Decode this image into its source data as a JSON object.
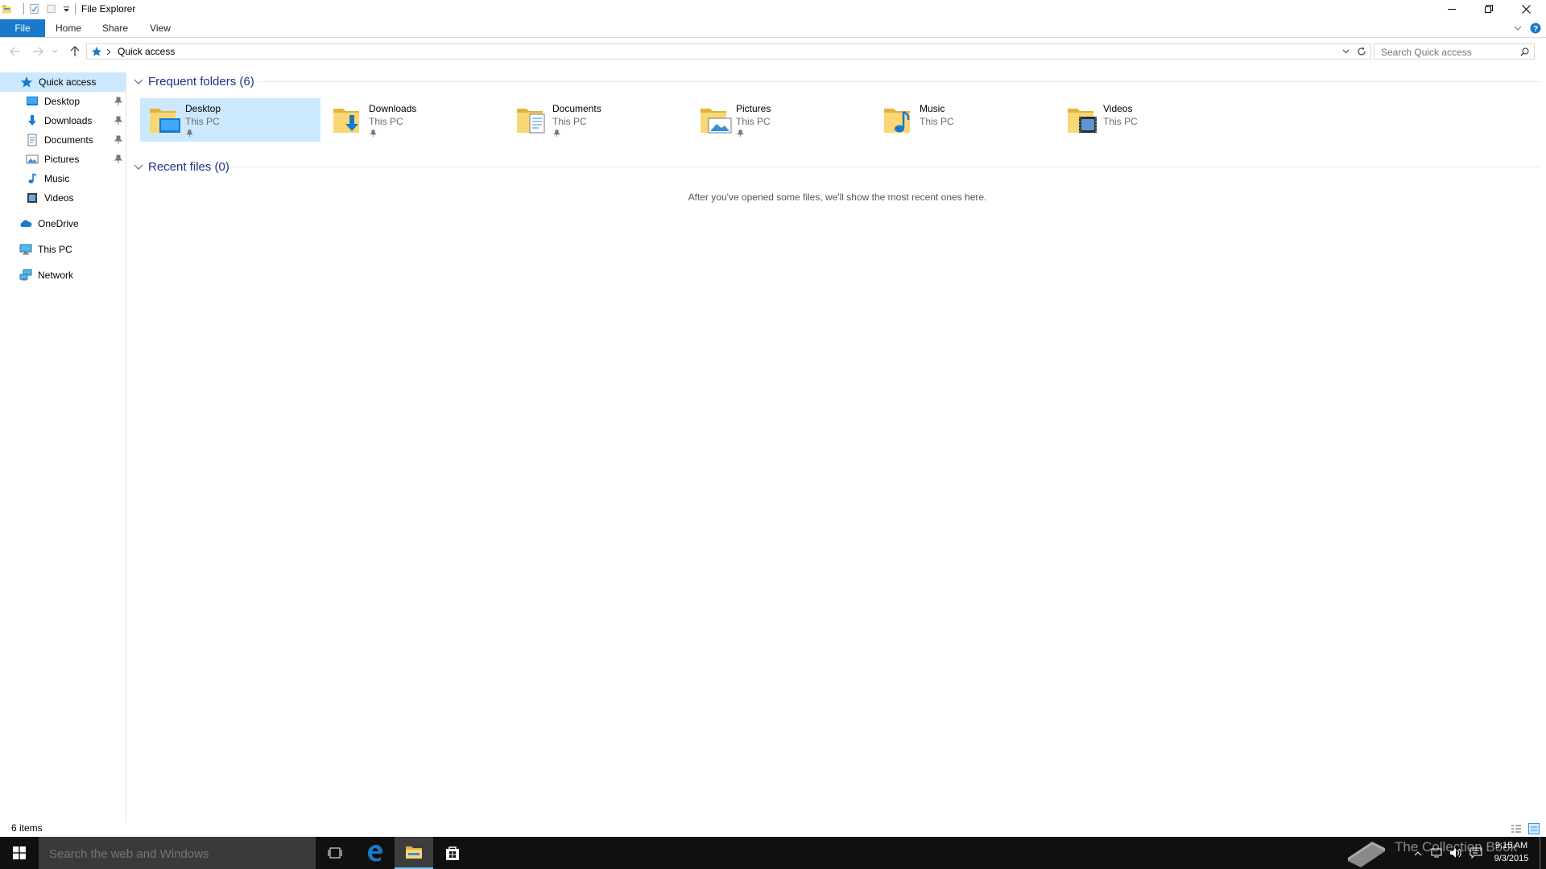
{
  "window": {
    "title": "File Explorer"
  },
  "ribbon": {
    "tabs": [
      {
        "label": "File"
      },
      {
        "label": "Home"
      },
      {
        "label": "Share"
      },
      {
        "label": "View"
      }
    ]
  },
  "address": {
    "location": "Quick access",
    "search_placeholder": "Search Quick access"
  },
  "nav_pane": {
    "items": [
      {
        "label": "Quick access",
        "icon": "star-icon",
        "selected": true
      },
      {
        "label": "Desktop",
        "icon": "desktop-icon",
        "pinned": true
      },
      {
        "label": "Downloads",
        "icon": "downloads-icon",
        "pinned": true
      },
      {
        "label": "Documents",
        "icon": "documents-icon",
        "pinned": true
      },
      {
        "label": "Pictures",
        "icon": "pictures-icon",
        "pinned": true
      },
      {
        "label": "Music",
        "icon": "music-icon"
      },
      {
        "label": "Videos",
        "icon": "videos-icon"
      },
      {
        "label": "OneDrive",
        "icon": "onedrive-icon"
      },
      {
        "label": "This PC",
        "icon": "pc-icon"
      },
      {
        "label": "Network",
        "icon": "network-icon"
      }
    ]
  },
  "frequent_folders": {
    "header": "Frequent folders (6)",
    "items": [
      {
        "name": "Desktop",
        "location": "This PC",
        "pinned": true,
        "selected": true,
        "icon": "desktop-folder-icon"
      },
      {
        "name": "Downloads",
        "location": "This PC",
        "pinned": true,
        "icon": "downloads-folder-icon"
      },
      {
        "name": "Documents",
        "location": "This PC",
        "pinned": true,
        "icon": "documents-folder-icon"
      },
      {
        "name": "Pictures",
        "location": "This PC",
        "pinned": true,
        "icon": "pictures-folder-icon"
      },
      {
        "name": "Music",
        "location": "This PC",
        "pinned": false,
        "icon": "music-folder-icon"
      },
      {
        "name": "Videos",
        "location": "This PC",
        "pinned": false,
        "icon": "videos-folder-icon"
      }
    ]
  },
  "recent_files": {
    "header": "Recent files (0)",
    "empty_message": "After you've opened some files, we'll show the most recent ones here."
  },
  "status": {
    "item_count": "6 items"
  },
  "taskbar": {
    "search_placeholder": "Search the web and Windows",
    "watermark": "The Collection Book",
    "clock_time": "9:15 AM",
    "clock_date": "9/3/2015"
  },
  "colors": {
    "accent": "#1979ca",
    "selection": "#cce8ff",
    "group_header": "#1e3287",
    "folder_yellow": "#f8d775",
    "taskbar": "#101010"
  }
}
